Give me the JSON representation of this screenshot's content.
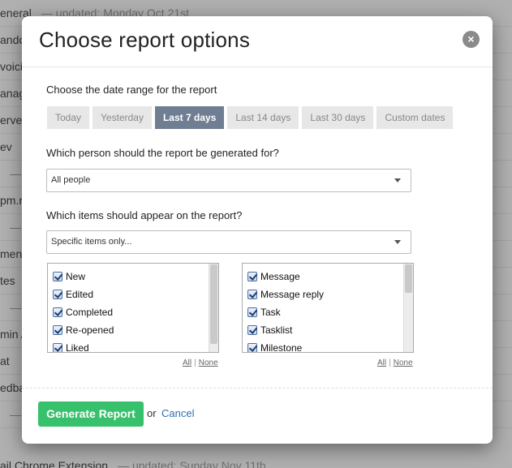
{
  "background": {
    "rows": [
      {
        "name": "eneral",
        "updated": "— updated: Monday Oct 21st"
      },
      {
        "name": "andon",
        "updated": ""
      },
      {
        "name": "voicin",
        "updated": ""
      },
      {
        "name": "anag",
        "updated": ""
      },
      {
        "name": "erver",
        "updated": ""
      },
      {
        "name": "ev",
        "updated": ""
      },
      {
        "name": "",
        "updated": "— u"
      },
      {
        "name": "pm.n",
        "updated": ""
      },
      {
        "name": "",
        "updated": "— up"
      },
      {
        "name": "men",
        "updated": ""
      },
      {
        "name": "tes",
        "updated": ""
      },
      {
        "name": "",
        "updated": "— up"
      },
      {
        "name": "min A",
        "updated": ""
      },
      {
        "name": "at",
        "updated": ""
      },
      {
        "name": "edba",
        "updated": ""
      },
      {
        "name": "",
        "updated": "— upd"
      },
      {
        "name": "ail Chrome Extension",
        "updated": "— updated: Sunday Nov 11th"
      }
    ]
  },
  "modal": {
    "title": "Choose report options",
    "close_icon": "×",
    "date_range": {
      "label": "Choose the date range for the report",
      "options": [
        "Today",
        "Yesterday",
        "Last 7 days",
        "Last 14 days",
        "Last 30 days",
        "Custom dates"
      ],
      "selected": "Last 7 days"
    },
    "person": {
      "label": "Which person should the report be generated for?",
      "value": "All people"
    },
    "items": {
      "label": "Which items should appear on the report?",
      "value": "Specific items only...",
      "left_list": [
        "New",
        "Edited",
        "Completed",
        "Re-opened",
        "Liked"
      ],
      "right_list": [
        "Message",
        "Message reply",
        "Task",
        "Tasklist",
        "Milestone"
      ],
      "all_label": "All",
      "separator": "|",
      "none_label": "None"
    },
    "footer": {
      "generate_label": "Generate Report",
      "or_text": "or",
      "cancel_label": "Cancel"
    }
  },
  "colors": {
    "accent_tab": "#6f7e92",
    "generate_button": "#37c16c",
    "link": "#2e6fb5"
  }
}
